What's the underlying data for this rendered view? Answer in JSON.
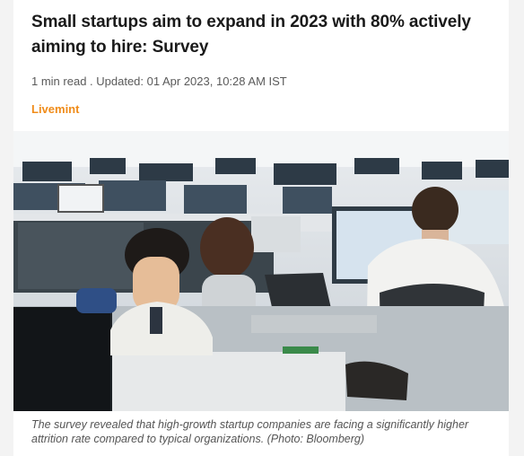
{
  "article": {
    "headline": "Small startups aim to expand in 2023 with 80% actively aiming to hire: Survey",
    "meta": "1 min read . Updated: 01 Apr 2023, 10:28 AM IST",
    "source": "Livemint",
    "caption": "The survey revealed that high-growth startup companies are facing a significantly higher attrition rate compared to typical organizations. (Photo: Bloomberg)",
    "photo_alt": "office-workers-at-computers-photo"
  },
  "colors": {
    "source": "#f08c1a",
    "headline": "#1a1a1a",
    "meta": "#5a5a5a"
  }
}
